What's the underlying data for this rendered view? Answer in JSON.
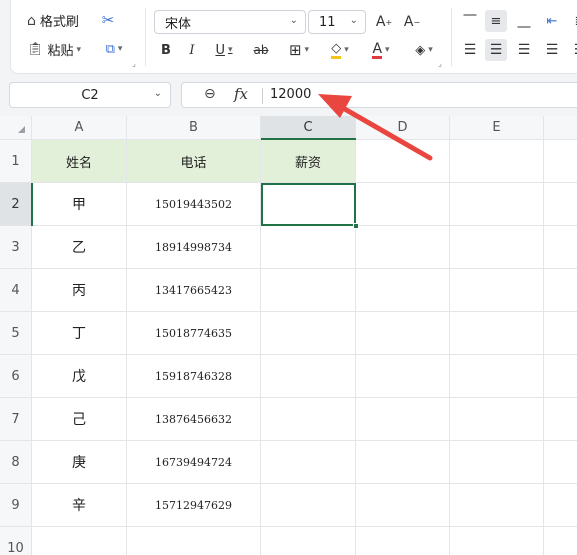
{
  "ribbon": {
    "format_painter_label": "格式刷",
    "paste_label": "粘贴",
    "font_name": "宋体",
    "font_size": "11",
    "bold": "B",
    "italic": "I",
    "underline": "U",
    "strike": "ab",
    "grow_font": "A",
    "shrink_font": "A",
    "font_color_letter": "A",
    "accent_red": "#e0393e",
    "accent_yellow": "#f5c518"
  },
  "formula_bar": {
    "cell_ref": "C2",
    "fx": "fx",
    "value": "12000"
  },
  "grid": {
    "columns": [
      "A",
      "B",
      "C",
      "D",
      "E"
    ],
    "rows": [
      "1",
      "2",
      "3",
      "4",
      "5",
      "6",
      "7",
      "8",
      "9",
      "10"
    ],
    "header": {
      "name": "姓名",
      "phone": "电话",
      "salary": "薪资"
    },
    "records": [
      {
        "name": "甲",
        "phone": "15019443502",
        "salary": ""
      },
      {
        "name": "乙",
        "phone": "18914998734",
        "salary": ""
      },
      {
        "name": "丙",
        "phone": "13417665423",
        "salary": ""
      },
      {
        "name": "丁",
        "phone": "15018774635",
        "salary": ""
      },
      {
        "name": "戊",
        "phone": "15918746328",
        "salary": ""
      },
      {
        "name": "己",
        "phone": "13876456632",
        "salary": ""
      },
      {
        "name": "庚",
        "phone": "16739494724",
        "salary": ""
      },
      {
        "name": "辛",
        "phone": "15712947629",
        "salary": ""
      }
    ],
    "selected_cell": "C2",
    "header_fill": "#e3f0d9",
    "selection_color": "#217346"
  },
  "annotation": {
    "arrow_color": "#e8463f"
  }
}
